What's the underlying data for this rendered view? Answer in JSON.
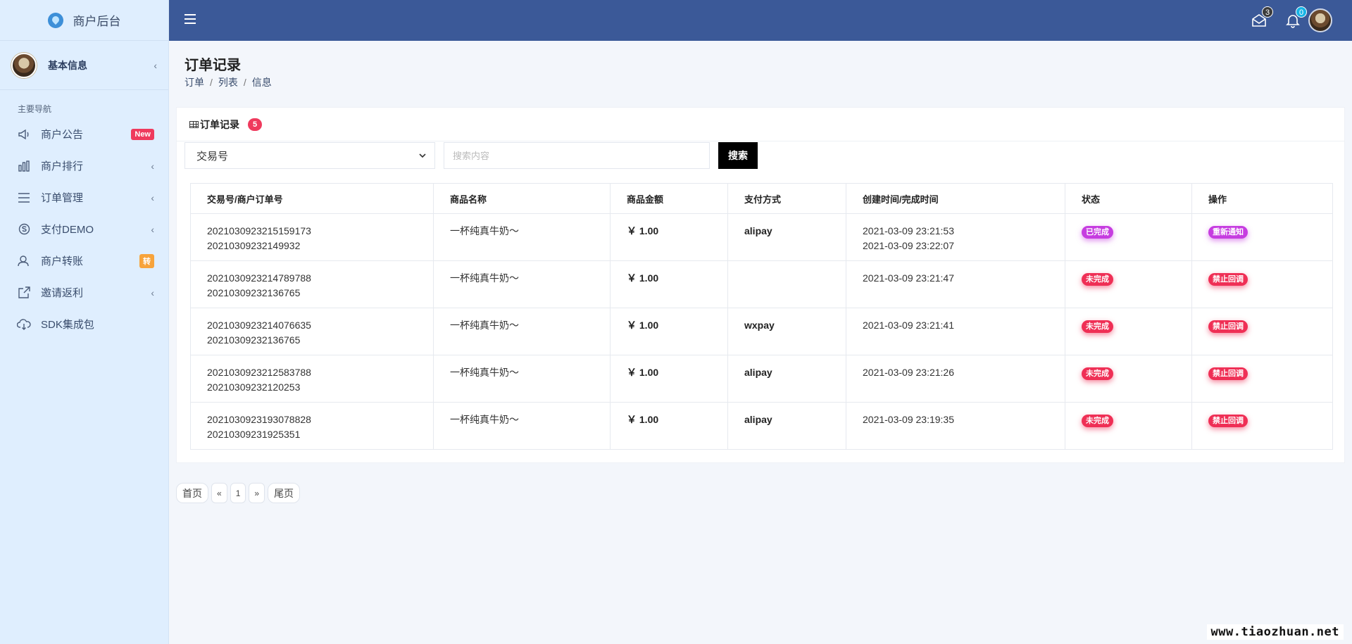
{
  "sidebar": {
    "brand": "商户后台",
    "user_label": "基本信息",
    "section_label": "主要导航",
    "items": [
      {
        "label": "商户公告",
        "badge": "New"
      },
      {
        "label": "商户排行"
      },
      {
        "label": "订单管理"
      },
      {
        "label": "支付DEMO"
      },
      {
        "label": "商户转账",
        "badge": "转"
      },
      {
        "label": "邀请返利"
      },
      {
        "label": "SDK集成包"
      }
    ]
  },
  "topbar": {
    "mail_count": "3",
    "bell_count": "0",
    "colors": {
      "bar": "#3b5998"
    }
  },
  "page": {
    "title": "订单记录",
    "breadcrumb": [
      "订单",
      "列表",
      "信息"
    ]
  },
  "card": {
    "title": "订单记录",
    "count": "5",
    "filter": {
      "selected": "交易号",
      "search_placeholder": "搜索内容",
      "search_button": "搜索"
    },
    "columns": [
      "交易号/商户订单号",
      "商品名称",
      "商品金额",
      "支付方式",
      "创建时间/完成时间",
      "状态",
      "操作"
    ],
    "rows": [
      {
        "trade_no": "2021030923215159173",
        "order_no": "20210309232149932",
        "product": "一杯纯真牛奶～",
        "amount": "￥ 1.00",
        "pay": "alipay",
        "created": "2021-03-09 23:21:53",
        "finished": "2021-03-09 23:22:07",
        "status": "已完成",
        "action": "重新通知"
      },
      {
        "trade_no": "2021030923214789788",
        "order_no": "20210309232136765",
        "product": "一杯纯真牛奶～",
        "amount": "￥ 1.00",
        "pay": "",
        "created": "2021-03-09 23:21:47",
        "finished": "",
        "status": "未完成",
        "action": "禁止回调"
      },
      {
        "trade_no": "2021030923214076635",
        "order_no": "20210309232136765",
        "product": "一杯纯真牛奶～",
        "amount": "￥ 1.00",
        "pay": "wxpay",
        "created": "2021-03-09 23:21:41",
        "finished": "",
        "status": "未完成",
        "action": "禁止回调"
      },
      {
        "trade_no": "2021030923212583788",
        "order_no": "20210309232120253",
        "product": "一杯纯真牛奶～",
        "amount": "￥ 1.00",
        "pay": "alipay",
        "created": "2021-03-09 23:21:26",
        "finished": "",
        "status": "未完成",
        "action": "禁止回调"
      },
      {
        "trade_no": "2021030923193078828",
        "order_no": "20210309231925351",
        "product": "一杯纯真牛奶～",
        "amount": "￥ 1.00",
        "pay": "alipay",
        "created": "2021-03-09 23:19:35",
        "finished": "",
        "status": "未完成",
        "action": "禁止回调"
      }
    ]
  },
  "pagination": {
    "first": "首页",
    "prev": "«",
    "current": "1",
    "next": "»",
    "last": "尾页"
  },
  "watermark": "www.tiaozhuan.net"
}
